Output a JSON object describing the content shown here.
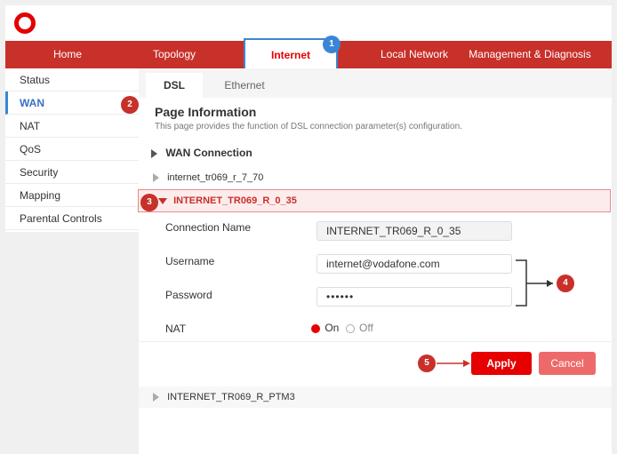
{
  "nav": {
    "items": [
      {
        "label": "Home"
      },
      {
        "label": "Topology"
      },
      {
        "label": "Internet"
      },
      {
        "label": "Local Network"
      },
      {
        "label": "Management & Diagnosis"
      }
    ]
  },
  "sidebar": {
    "items": [
      {
        "label": "Status"
      },
      {
        "label": "WAN"
      },
      {
        "label": "NAT"
      },
      {
        "label": "QoS"
      },
      {
        "label": "Security"
      },
      {
        "label": "Mapping"
      },
      {
        "label": "Parental Controls"
      }
    ]
  },
  "subtabs": [
    {
      "label": "DSL"
    },
    {
      "label": "Ethernet"
    }
  ],
  "page": {
    "title": "Page Information",
    "description": "This page provides the function of DSL connection parameter(s) configuration."
  },
  "wan": {
    "section_title": "WAN Connection",
    "connections": [
      {
        "name": "internet_tr069_r_7_70"
      },
      {
        "name": "INTERNET_TR069_R_0_35"
      },
      {
        "name": "INTERNET_TR069_R_PTM3"
      }
    ]
  },
  "form": {
    "connection_name_label": "Connection Name",
    "connection_name_value": "INTERNET_TR069_R_0_35",
    "username_label": "Username",
    "username_value": "internet@vodafone.com",
    "password_label": "Password",
    "password_value": "••••••",
    "nat_label": "NAT",
    "nat_on_label": "On",
    "nat_off_label": "Off"
  },
  "buttons": {
    "apply": "Apply",
    "cancel": "Cancel"
  },
  "callouts": [
    "1",
    "2",
    "3",
    "4",
    "5"
  ],
  "colors": {
    "brand_red": "#c8302a",
    "apply_red": "#e60000",
    "cancel_red": "#ee6a6a",
    "callout_blue": "#3a86d6",
    "selected_row_bg": "#fdecec"
  }
}
